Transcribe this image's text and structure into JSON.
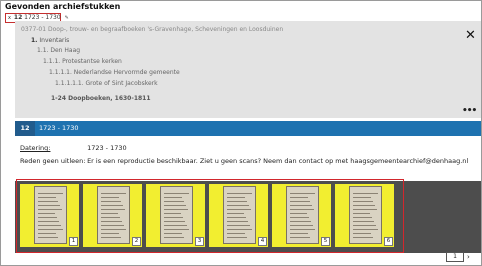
{
  "header": {
    "title": "Gevonden archiefstukken"
  },
  "filter": {
    "remove": "x",
    "number": "12",
    "range": "1723 - 1730",
    "edit_icon": "pencil-icon"
  },
  "tree": {
    "archive": "0377-01 Doop-, trouw- en begraafboeken 's-Gravenhage, Scheveningen en Loosduinen",
    "level1_num": "1.",
    "level1_label": "Inventaris",
    "level2": "1.1. Den Haag",
    "level3": "1.1.1. Protestantse kerken",
    "level4": "1.1.1.1. Nederlandse Hervormde gemeente",
    "level5": "1.1.1.1.1. Grote of Sint Jacobskerk",
    "level6": "1-24 Doopboeken, 1630-1811"
  },
  "panel": {
    "close_icon": "close-icon",
    "close_glyph": "✕",
    "more_icon": "more-icon",
    "more_glyph": "•••"
  },
  "record": {
    "number": "12",
    "title": "1723 - 1730"
  },
  "meta": {
    "dating_label": "Datering:",
    "dating_value": "1723 - 1730",
    "reason_label": "Reden geen uitleen:",
    "reason_value": "Er is een reproductie beschikbaar. Ziet u geen scans? Neem dan contact op met haagsgemeentearchief@denhaag.nl"
  },
  "thumbnails": [
    {
      "index": "1"
    },
    {
      "index": "2"
    },
    {
      "index": "3"
    },
    {
      "index": "4"
    },
    {
      "index": "5"
    },
    {
      "index": "6"
    }
  ],
  "pagination": {
    "page": "1",
    "next_icon": "chevron-right-icon",
    "next_glyph": "›"
  },
  "colors": {
    "accent": "#1e72b0",
    "highlight": "#f2ee30",
    "outline": "#d2272d"
  }
}
